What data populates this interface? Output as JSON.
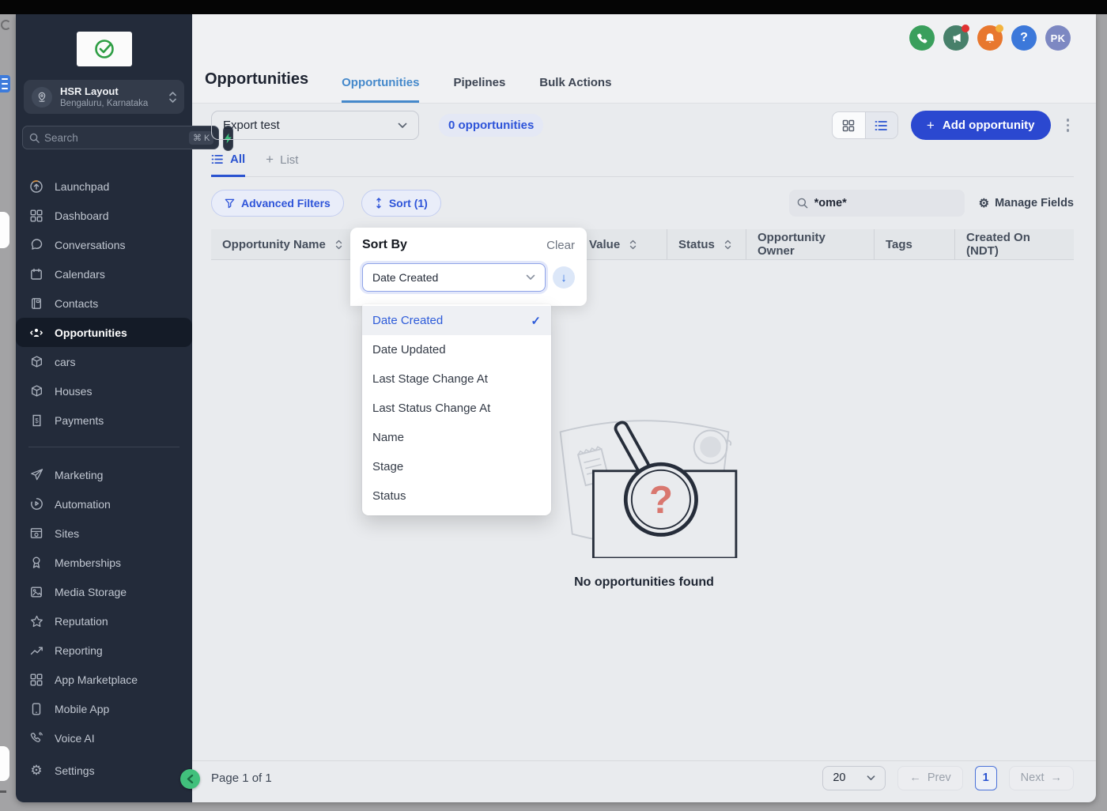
{
  "icons": {
    "plus": "+",
    "check": "✓",
    "arrow_down": "↓",
    "prev_arrow": "←",
    "next_arrow": "→",
    "help": "?",
    "gear": "⚙"
  },
  "sidebar": {
    "location": {
      "name": "HSR Layout",
      "city": "Bengaluru, Karnataka"
    },
    "search_placeholder": "Search",
    "search_shortcut": "⌘ K",
    "group1": [
      "Launchpad",
      "Dashboard",
      "Conversations",
      "Calendars",
      "Contacts",
      "Opportunities",
      "cars",
      "Houses",
      "Payments"
    ],
    "group2": [
      "Marketing",
      "Automation",
      "Sites",
      "Memberships",
      "Media Storage",
      "Reputation",
      "Reporting",
      "App Marketplace",
      "Mobile App",
      "Voice AI"
    ],
    "settings": "Settings"
  },
  "header": {
    "page_title": "Opportunities",
    "tabs": [
      "Opportunities",
      "Pipelines",
      "Bulk Actions"
    ],
    "avatar_initials": "PK"
  },
  "toolbar": {
    "view_selector": "Export test",
    "opportunity_count": "0 opportunities",
    "add_button": "Add opportunity"
  },
  "list_tabs": {
    "all": "All",
    "add_list": "List"
  },
  "filters": {
    "advanced": "Advanced Filters",
    "sort": "Sort (1)",
    "search_value": "*ome*",
    "manage_fields": "Manage Fields"
  },
  "table": {
    "columns": [
      "Opportunity Name",
      "Opportunity Value",
      "Status",
      "Opportunity Owner",
      "Tags",
      "Created On (NDT)"
    ]
  },
  "empty_state": {
    "message": "No opportunities found"
  },
  "sort_popup": {
    "title": "Sort By",
    "clear": "Clear",
    "field_value": "Date Created",
    "options": [
      "Date Created",
      "Date Updated",
      "Last Stage Change At",
      "Last Status Change At",
      "Name",
      "Stage",
      "Status"
    ]
  },
  "pagination": {
    "page_info": "Page 1 of 1",
    "page_size": "20",
    "prev": "Prev",
    "current_page": "1",
    "next": "Next"
  },
  "colors": {
    "brand_blue": "#2b48d0",
    "link_blue": "#2e54d9",
    "phone_green": "#3a9f5c",
    "megaphone_green": "#47806a",
    "bell_orange": "#e8772e",
    "help_blue": "#3c78da",
    "avatar_purple": "#7d88c2",
    "sidebar_bg": "#232b3a"
  }
}
